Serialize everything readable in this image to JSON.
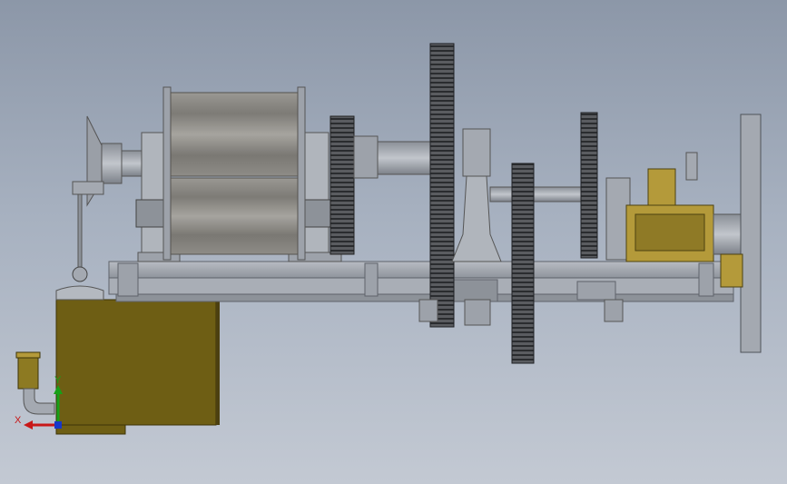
{
  "viewport": {
    "background_top": "#8c97a8",
    "background_bottom": "#c3c9d3"
  },
  "triad": {
    "x_label": "X",
    "y_label": "Y",
    "x_color": "#c81818",
    "y_color": "#18a018",
    "z_color": "#1838c8"
  },
  "colors": {
    "steel": "#a4a9b1",
    "steel_dark": "#6f747c",
    "gear": "#3a3c40",
    "bronze": "#6e5e14",
    "brass": "#b49a3a"
  }
}
